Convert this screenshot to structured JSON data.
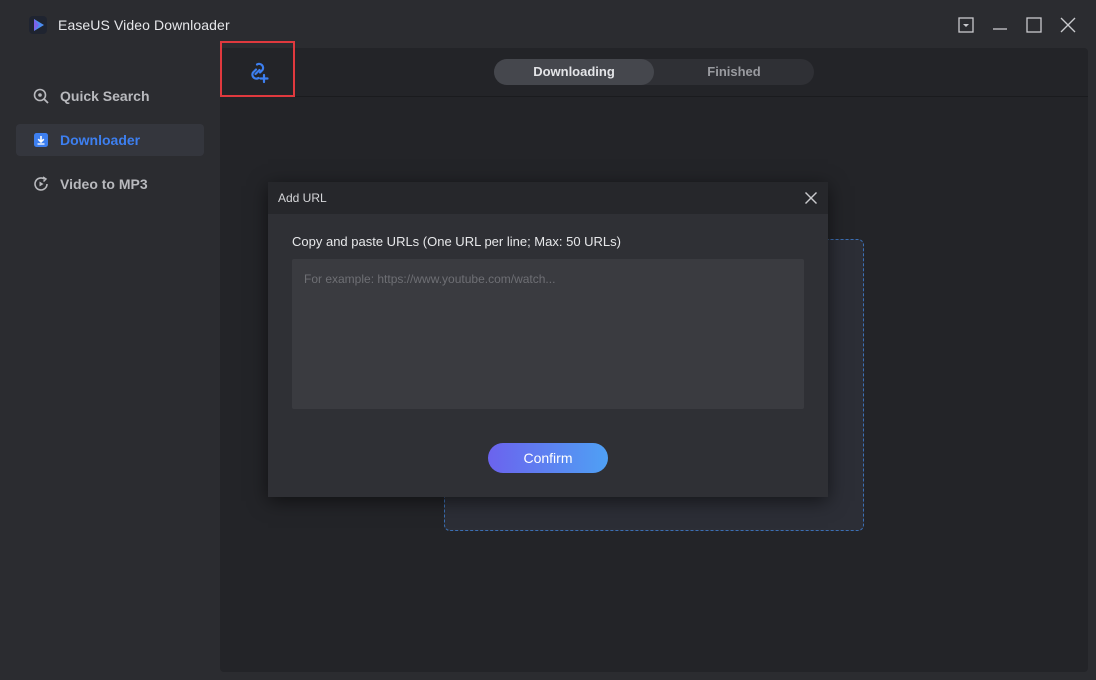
{
  "app": {
    "title": "EaseUS Video Downloader",
    "accent_color": "#3d7ff0"
  },
  "window_controls": [
    {
      "name": "menu-dropdown-icon"
    },
    {
      "name": "minimize-icon"
    },
    {
      "name": "maximize-icon"
    },
    {
      "name": "close-icon"
    }
  ],
  "sidebar": {
    "items": [
      {
        "label": "Quick Search",
        "icon": "search-icon",
        "active": false
      },
      {
        "label": "Downloader",
        "icon": "download-icon",
        "active": true
      },
      {
        "label": "Video to MP3",
        "icon": "convert-icon",
        "active": false
      }
    ]
  },
  "toolbar": {
    "add_url_icon": "link-add-icon"
  },
  "tabs": [
    {
      "label": "Downloading",
      "active": true
    },
    {
      "label": "Finished",
      "active": false
    }
  ],
  "dialog": {
    "title": "Add URL",
    "instruction": "Copy and paste URLs (One URL per line; Max: 50 URLs)",
    "input_placeholder": "For example: https://www.youtube.com/watch...",
    "input_value": "",
    "confirm_label": "Confirm",
    "confirm_gradient": [
      "#6b63ee",
      "#4fa0f4"
    ]
  }
}
